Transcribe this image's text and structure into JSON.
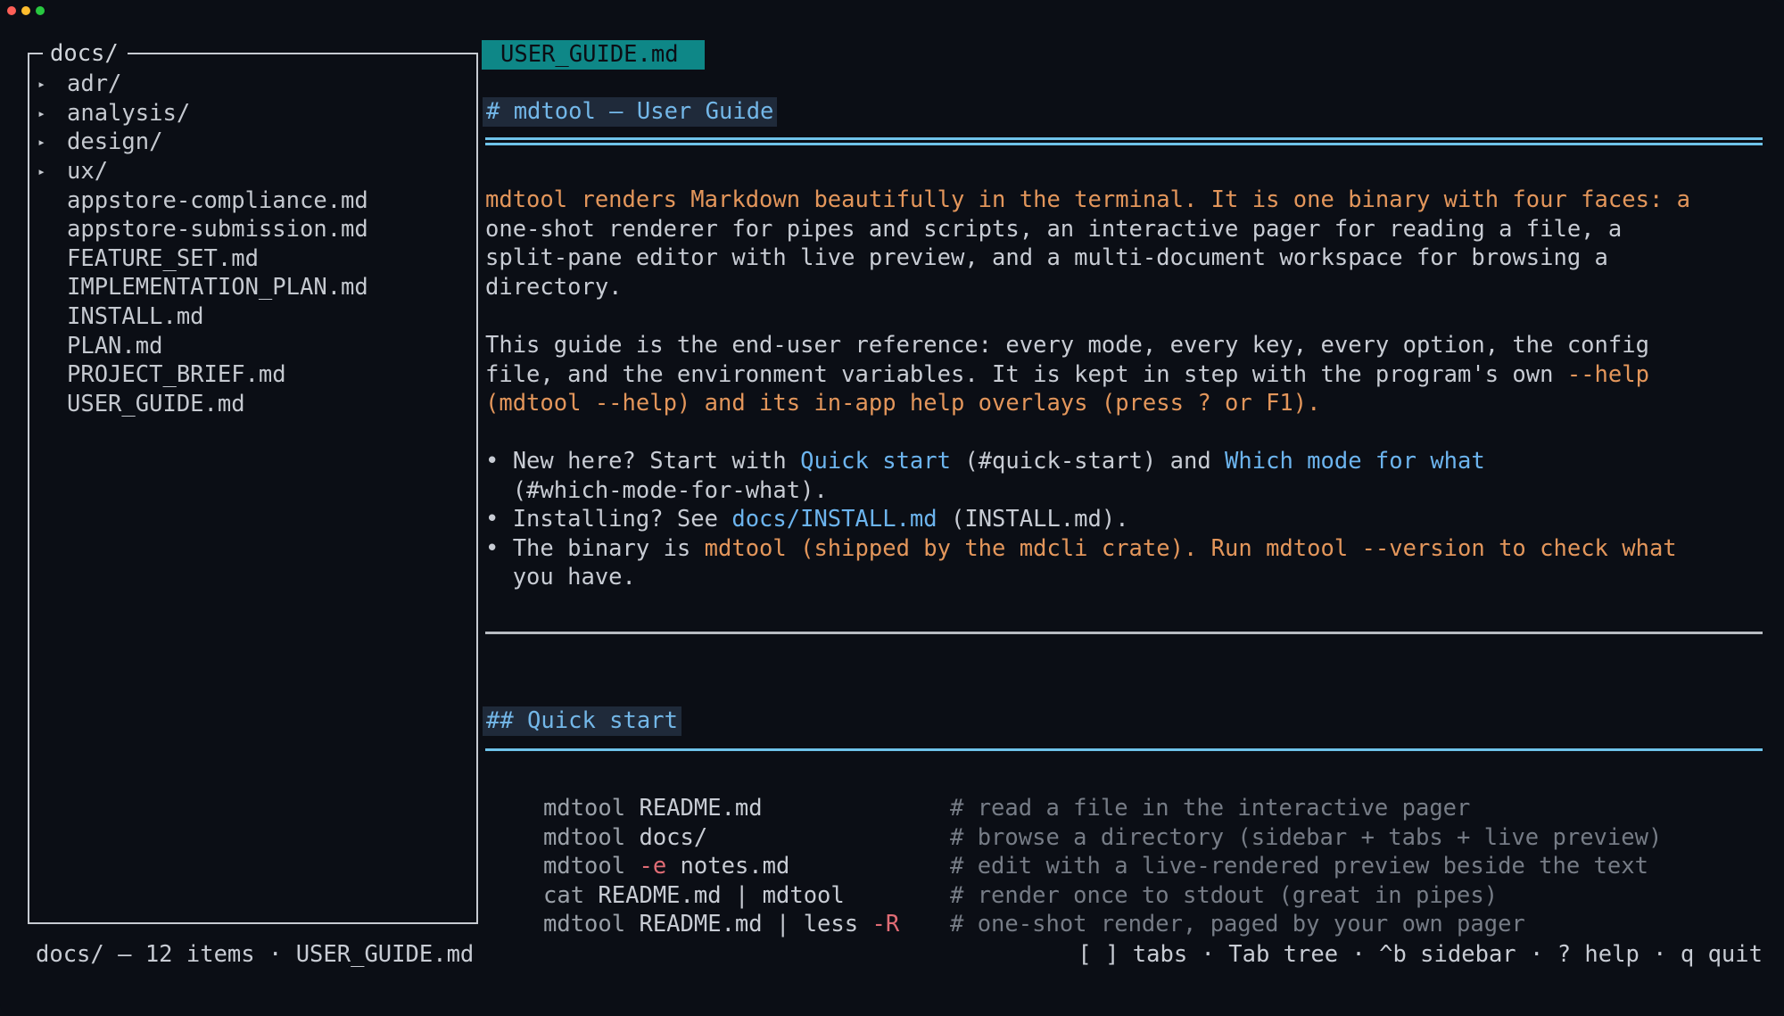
{
  "sidebar": {
    "title": "docs/",
    "items": [
      {
        "label": "adr/",
        "type": "folder",
        "arrow": "▸"
      },
      {
        "label": "analysis/",
        "type": "folder",
        "arrow": "▸"
      },
      {
        "label": "design/",
        "type": "folder",
        "arrow": "▸"
      },
      {
        "label": "ux/",
        "type": "folder",
        "arrow": "▸"
      },
      {
        "label": "appstore-compliance.md",
        "type": "file",
        "arrow": ""
      },
      {
        "label": "appstore-submission.md",
        "type": "file",
        "arrow": ""
      },
      {
        "label": "FEATURE_SET.md",
        "type": "file",
        "arrow": ""
      },
      {
        "label": "IMPLEMENTATION_PLAN.md",
        "type": "file",
        "arrow": ""
      },
      {
        "label": "INSTALL.md",
        "type": "file",
        "arrow": ""
      },
      {
        "label": "PLAN.md",
        "type": "file",
        "arrow": ""
      },
      {
        "label": "PROJECT_BRIEF.md",
        "type": "file",
        "arrow": ""
      },
      {
        "label": "USER_GUIDE.md",
        "type": "file",
        "arrow": ""
      }
    ]
  },
  "tab": {
    "label": "USER_GUIDE.md"
  },
  "doc": {
    "h1": "# mdtool — User Guide",
    "p1": {
      "line1": "mdtool renders Markdown beautifully in the terminal. It is one binary with four faces: a",
      "line2": "one-shot renderer for pipes and scripts, an interactive pager for reading a file, a",
      "line3": "split-pane editor with live preview, and a multi-document workspace for browsing a",
      "line4": "directory."
    },
    "p2": {
      "line1": "This guide is the end-user reference: every mode, every key, every option, the config",
      "line2a": "file, and the environment variables. It is kept in step with the program's own ",
      "line2b": "--help",
      "line3": "(mdtool --help) and its in-app help overlays (press ? or F1)."
    },
    "bullets": {
      "b1a": "• New here? Start with ",
      "b1link1": "Quick start",
      "b1b": " (#quick-start) and ",
      "b1link2": "Which mode for what",
      "b1c": "  (#which-mode-for-what).",
      "b2a": "• Installing? See ",
      "b2link": "docs/INSTALL.md",
      "b2b": " (INSTALL.md).",
      "b3a": "• The binary is ",
      "b3orange": "mdtool (shipped by the mdcli crate). Run mdtool --version to check what",
      "b3b": "  you have."
    },
    "h2": "## Quick start",
    "code": [
      {
        "pre": "mdtool ",
        "mid": "README.md",
        "flag": "",
        "post": "",
        "comment": "# read a file in the interactive pager"
      },
      {
        "pre": "mdtool ",
        "mid": "docs/",
        "flag": "",
        "post": "",
        "comment": "# browse a directory (sidebar + tabs + live preview)"
      },
      {
        "pre": "mdtool ",
        "mid": "",
        "flag": "-e",
        "post": " notes.md",
        "comment": "# edit with a live-rendered preview beside the text"
      },
      {
        "pre": "cat ",
        "mid": "README.md | mdtool",
        "flag": "",
        "post": "",
        "comment": "# render once to stdout (great in pipes)"
      },
      {
        "pre": "mdtool ",
        "mid": "README.md | less ",
        "flag": "-R",
        "post": "",
        "comment": "# one-shot render, paged by your own pager"
      }
    ]
  },
  "status": {
    "left": "docs/ — 12 items · USER_GUIDE.md",
    "right": "[ ] tabs · Tab tree · ^b sidebar · ? help · q quit"
  }
}
